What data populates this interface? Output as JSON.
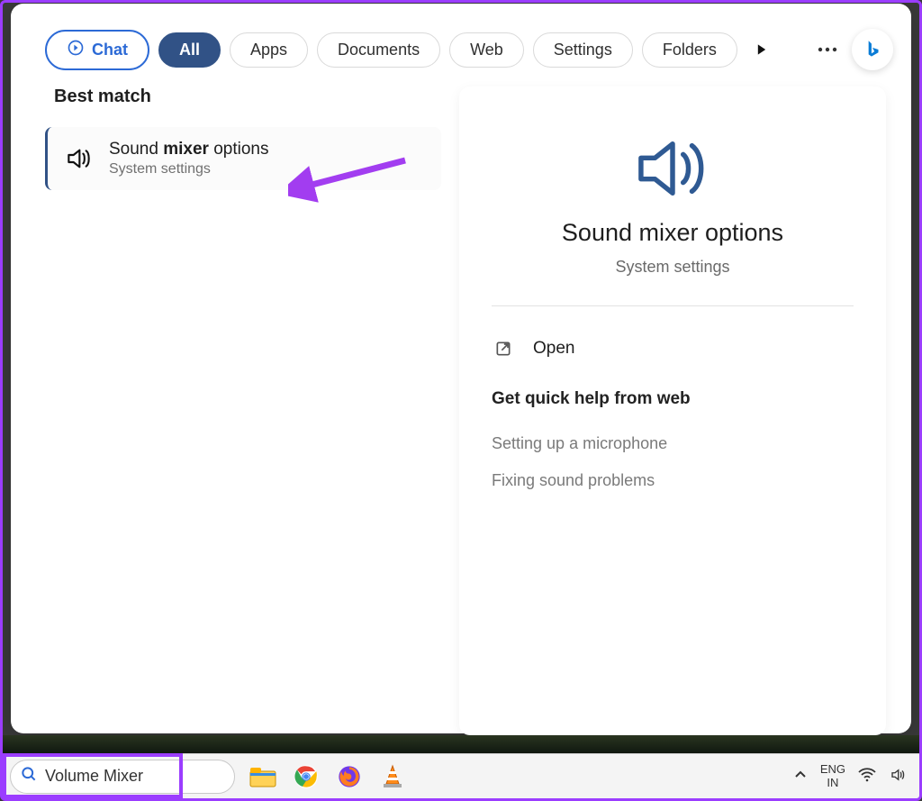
{
  "filters": {
    "chat": "Chat",
    "all": "All",
    "apps": "Apps",
    "documents": "Documents",
    "web": "Web",
    "settings": "Settings",
    "folders": "Folders"
  },
  "left": {
    "section_title": "Best match",
    "result": {
      "pre": "Sound ",
      "bold": "mixer",
      "post": " options",
      "sub": "System settings"
    }
  },
  "details": {
    "title": "Sound mixer options",
    "sub": "System settings",
    "open": "Open",
    "help_header": "Get quick help from web",
    "help_links": {
      "mic": "Setting up a microphone",
      "fix": "Fixing sound problems"
    }
  },
  "taskbar": {
    "search_value": "Volume Mixer",
    "lang_top": "ENG",
    "lang_bottom": "IN"
  }
}
